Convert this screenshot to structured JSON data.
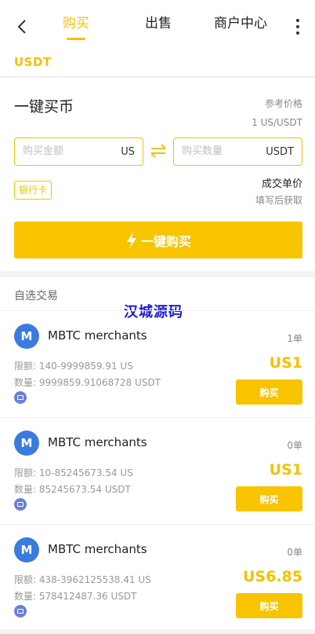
{
  "nav": {
    "tabs": [
      {
        "label": "购买",
        "active": true
      },
      {
        "label": "出售",
        "active": false
      },
      {
        "label": "商户中心",
        "active": false
      }
    ]
  },
  "coin": "USDT",
  "quick": {
    "title": "一键买币",
    "ref_label": "参考价格",
    "ref_value": "1 US/USDT",
    "amount_placeholder": "购买金额",
    "amount_unit": "US",
    "qty_placeholder": "购买数量",
    "qty_unit": "USDT",
    "pay_tag": "银行卡",
    "deal_label": "成交单价",
    "deal_hint": "填写后获取",
    "buy_label": "一键购买"
  },
  "list": {
    "title": "自选交易",
    "watermark": "汉城源码",
    "merchants": [
      {
        "avatar": "M",
        "name": "MBTC merchants",
        "orders": "1单",
        "limit": "限额: 140-9999859.91 US",
        "qty": "数量: 9999859.91068728 USDT",
        "price": "US1",
        "buy_label": "购买"
      },
      {
        "avatar": "M",
        "name": "MBTC merchants",
        "orders": "0单",
        "limit": "限额: 10-85245673.54 US",
        "qty": "数量: 85245673.54 USDT",
        "price": "US1",
        "buy_label": "购买"
      },
      {
        "avatar": "M",
        "name": "MBTC merchants",
        "orders": "0单",
        "limit": "限额: 438-3962125538.41 US",
        "qty": "数量: 578412487.36 USDT",
        "price": "US6.85",
        "buy_label": "购买"
      }
    ]
  },
  "colors": {
    "accent": "#f2c200",
    "button": "#f8c400",
    "avatar": "#3a7be0"
  }
}
